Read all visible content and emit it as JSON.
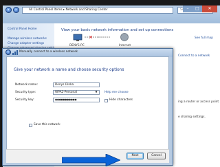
{
  "background_window": {
    "address": "All Control Panel Items  ▸  Network and Sharing Center",
    "search_placeholder": "Search Control Panel",
    "sidebar": {
      "home": "Control Panel Home",
      "items": [
        "Manage wireless networks",
        "Change adapter settings",
        "Change advanced sharing settings"
      ]
    },
    "main": {
      "heading": "View your basic network information and set up connections",
      "see_full_map": "See full map",
      "computer": "DENYS-PC",
      "internet": "Internet",
      "connect_link": "Connect to a network",
      "side_text_1": "ing a router or access point.",
      "side_text_2": "e sharing settings."
    }
  },
  "dialog": {
    "title": "Manually connect to a wireless network",
    "heading": "Give your network a name and choose security options",
    "network_name_label": "Network name:",
    "network_name_value": "Denys Dinka",
    "security_type_label": "Security type:",
    "security_type_value": "WPA2-Personal",
    "help_link": "Help me choose",
    "security_key_label": "Security key:",
    "security_key_value": "●●●●●●●●●●●",
    "hide_characters": "Hide characters",
    "save_network": "Save this network",
    "next_button": "Next",
    "cancel_button": "Cancel"
  },
  "colors": {
    "arrow": "#0a63d8",
    "link": "#1f4d9b"
  }
}
